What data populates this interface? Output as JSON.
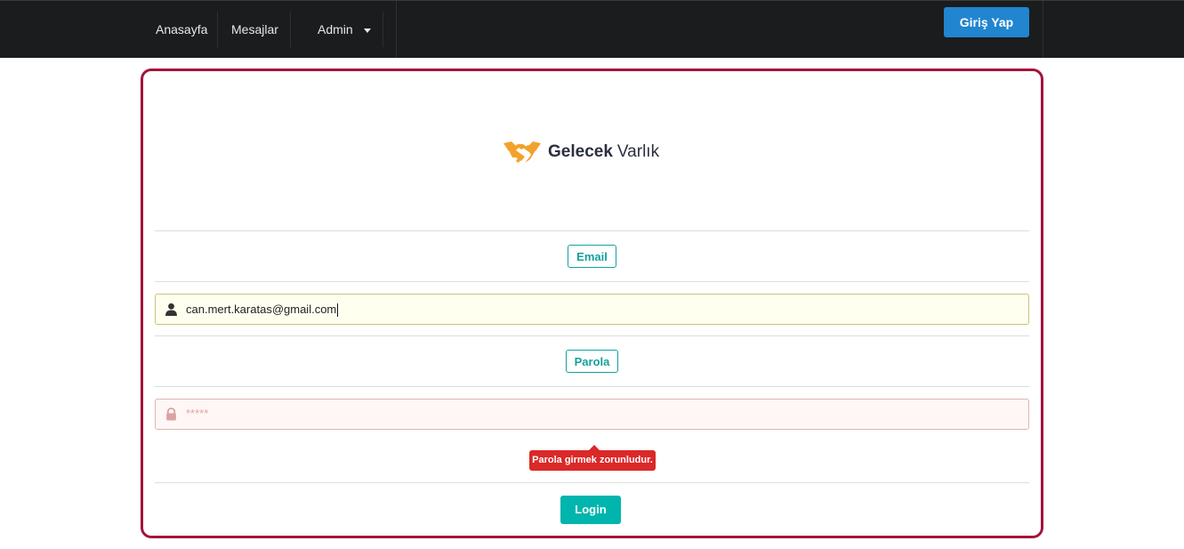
{
  "navbar": {
    "items": [
      {
        "label": "Anasayfa"
      },
      {
        "label": "Mesajlar"
      },
      {
        "label": "Admin"
      }
    ],
    "login_button": "Giriş Yap"
  },
  "logo": {
    "bold": "Gelecek",
    "regular": "Varlık",
    "icon": "handshake-icon",
    "color": "#f2a22c"
  },
  "form": {
    "email_label": "Email",
    "email_value": "can.mert.karatas@gmail.com",
    "email_icon": "user-icon",
    "password_label": "Parola",
    "password_placeholder": "*****",
    "password_icon": "lock-icon",
    "password_error": "Parola girmek zorunludur.",
    "submit_label": "Login"
  },
  "colors": {
    "navbar": "#1b1c1e",
    "primary": "#2185d0",
    "teal": "#00b5ad",
    "error": "#db2828",
    "card_border": "#a4143b"
  }
}
